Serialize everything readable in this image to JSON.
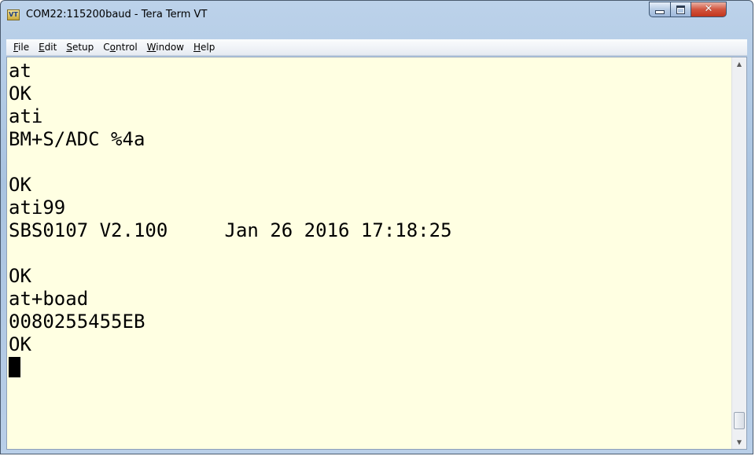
{
  "window": {
    "title": "COM22:115200baud - Tera Term VT",
    "icon_label": "VT"
  },
  "menu": {
    "items": [
      {
        "accel": "F",
        "rest": "ile"
      },
      {
        "accel": "E",
        "rest": "dit"
      },
      {
        "accel": "S",
        "rest": "etup"
      },
      {
        "pre": "C",
        "accel": "o",
        "rest": "ntrol"
      },
      {
        "accel": "W",
        "rest": "indow"
      },
      {
        "accel": "H",
        "rest": "elp"
      }
    ]
  },
  "terminal": {
    "background": "#ffffe2",
    "foreground": "#000000",
    "lines": [
      "at",
      "OK",
      "ati",
      "BM+S/ADC %4a",
      "",
      "OK",
      "ati99",
      "SBS0107 V2.100     Jan 26 2016 17:18:25",
      "",
      "OK",
      "at+boad",
      "0080255455EB",
      "OK"
    ]
  },
  "colors": {
    "titlebar": "#b9cfe8",
    "close_button": "#c2351c",
    "terminal_bg": "#ffffe2"
  },
  "icons": {
    "app": "tera-term-vt-icon",
    "minimize": "minimize-icon",
    "maximize": "maximize-icon",
    "close": "close-icon",
    "scroll_up": "scroll-up-arrow-icon",
    "scroll_down": "scroll-down-arrow-icon"
  }
}
